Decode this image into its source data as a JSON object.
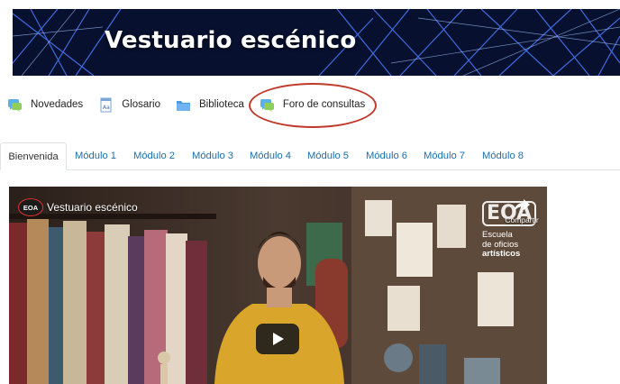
{
  "banner": {
    "title": "Vestuario escénico"
  },
  "resources": [
    {
      "label": "Novedades",
      "icon": "forum-icon"
    },
    {
      "label": "Glosario",
      "icon": "glossary-icon"
    },
    {
      "label": "Biblioteca",
      "icon": "folder-icon"
    },
    {
      "label": "Foro de consultas",
      "icon": "forum-icon"
    }
  ],
  "tabs": [
    {
      "label": "Bienvenida",
      "active": true
    },
    {
      "label": "Módulo 1"
    },
    {
      "label": "Módulo 2"
    },
    {
      "label": "Módulo 3"
    },
    {
      "label": "Módulo 4"
    },
    {
      "label": "Módulo 5"
    },
    {
      "label": "Módulo 6"
    },
    {
      "label": "Módulo 7"
    },
    {
      "label": "Módulo 8"
    }
  ],
  "video": {
    "channel_logo": "EOA",
    "title": "Vestuario escénico",
    "share_label": "Compartir",
    "brand_logo": "EOA",
    "brand_line1": "Escuela",
    "brand_line2": "de oficios",
    "brand_line3": "artísticos"
  },
  "colors": {
    "accent": "#1e6fa8",
    "highlight": "#c0392b",
    "banner": "#07102e"
  }
}
